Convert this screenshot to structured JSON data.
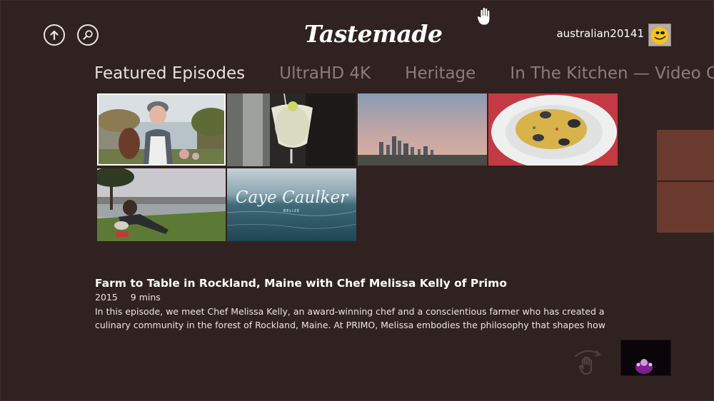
{
  "header": {
    "logo_text": "Tastemade",
    "username": "australian20141"
  },
  "icons": {
    "back": "back-arrow-icon",
    "search": "search-icon",
    "cursor": "hand-cursor-icon",
    "avatar": "smiley-avatar-icon",
    "gesture": "swipe-gesture-icon"
  },
  "tabs": [
    {
      "label": "Featured Episodes",
      "active": true
    },
    {
      "label": "UltraHD 4K",
      "active": false
    },
    {
      "label": "Heritage",
      "active": false
    },
    {
      "label": "In The Kitchen — Video Cla",
      "active": false
    }
  ],
  "tiles": [
    {
      "name": "farm-to-table",
      "selected": true
    },
    {
      "name": "cocktail"
    },
    {
      "name": "city-skyline"
    },
    {
      "name": "pasta-clams"
    },
    {
      "name": "harbor-picnic"
    },
    {
      "name": "caye-caulker",
      "overlay_title": "Caye Caulker",
      "overlay_subtitle": "BELIZE"
    }
  ],
  "episode": {
    "title": "Farm to Table in Rockland, Maine with Chef Melissa Kelly of Primo",
    "year": "2015",
    "duration": "9 mins",
    "description": "In this episode, we meet Chef Melissa Kelly, an award-winning chef and a conscientious farmer who has created a culinary community in the forest of Rockland, Maine. At PRIMO, Melissa embodies the philosophy that shapes how she"
  },
  "colors": {
    "background": "#302220",
    "accent_panel": "#6b3a2f",
    "tab_inactive": "#8a7d7a"
  }
}
